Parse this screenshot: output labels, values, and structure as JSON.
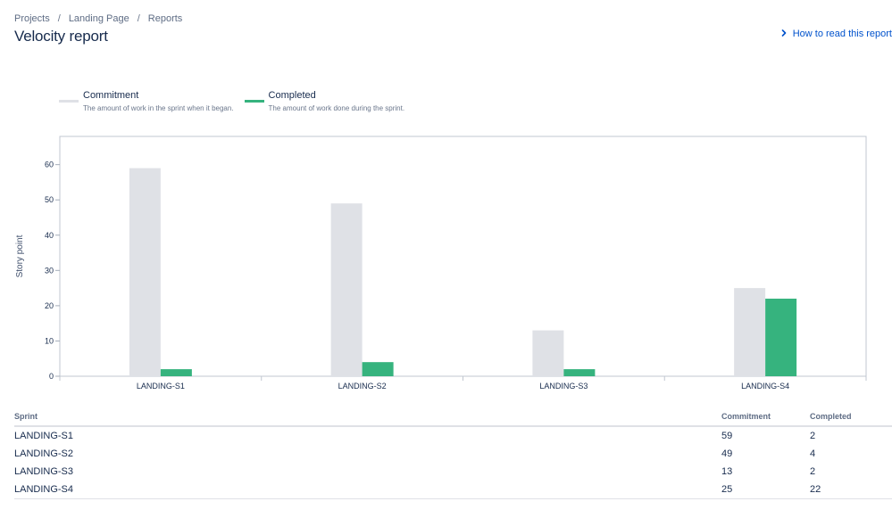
{
  "breadcrumb": {
    "items": [
      "Projects",
      "Landing Page",
      "Reports"
    ]
  },
  "page": {
    "title": "Velocity report",
    "help_link": "How to read this report"
  },
  "legend": [
    {
      "title": "Commitment",
      "description": "The amount of work in the sprint when it began.",
      "color": "#dfe1e6"
    },
    {
      "title": "Completed",
      "description": "The amount of work done during the sprint.",
      "color": "#36b37e"
    }
  ],
  "chart_data": {
    "type": "bar",
    "categories": [
      "LANDING-S1",
      "LANDING-S2",
      "LANDING-S3",
      "LANDING-S4"
    ],
    "series": [
      {
        "name": "Commitment",
        "values": [
          59,
          49,
          13,
          25
        ],
        "color": "#dfe1e6"
      },
      {
        "name": "Completed",
        "values": [
          2,
          4,
          2,
          22
        ],
        "color": "#36b37e"
      }
    ],
    "ylabel": "Story point",
    "ylim": [
      0,
      68
    ],
    "yticks": [
      0,
      10,
      20,
      30,
      40,
      50,
      60
    ]
  },
  "table": {
    "headers": [
      "Sprint",
      "Commitment",
      "Completed"
    ],
    "rows": [
      [
        "LANDING-S1",
        "59",
        "2"
      ],
      [
        "LANDING-S2",
        "49",
        "4"
      ],
      [
        "LANDING-S3",
        "13",
        "2"
      ],
      [
        "LANDING-S4",
        "25",
        "22"
      ]
    ]
  }
}
